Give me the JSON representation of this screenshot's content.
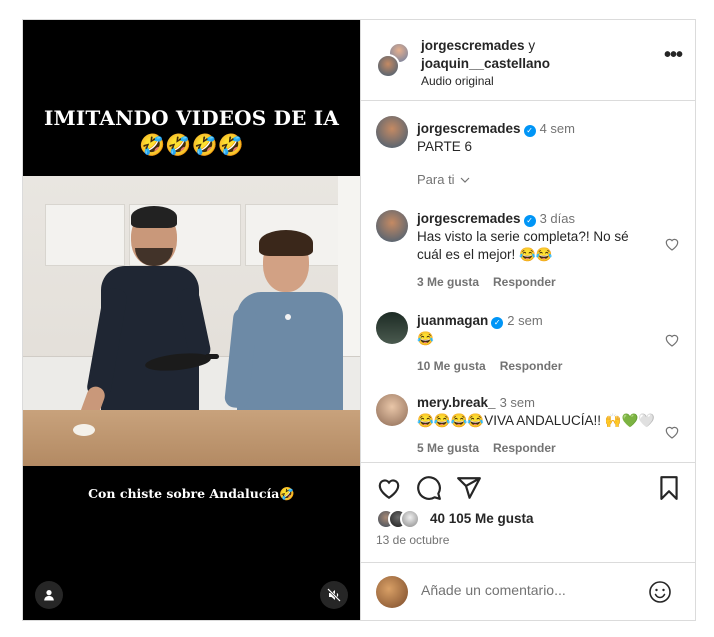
{
  "video": {
    "title": "IMITANDO VIDEOS DE IA",
    "title_emojis": "🤣🤣🤣🤣",
    "caption": "Con chiste sobre Andalucía🤣",
    "user_icon": "person-icon",
    "mute_icon": "speaker-muted-icon"
  },
  "header": {
    "user1": "jorgescremades",
    "conj": "y",
    "user2": "joaquin__castellano",
    "audio": "Audio original",
    "more": "•••"
  },
  "caption_comment": {
    "user": "jorgescremades",
    "time": "4 sem",
    "text": "PARTE 6",
    "see_translation": "Para ti"
  },
  "comments": [
    {
      "user": "jorgescremades",
      "verified": true,
      "time": "3 días",
      "text": "Has visto la serie completa?! No sé cuál es el mejor! 😂😂",
      "likes": "3 Me gusta",
      "reply": "Responder"
    },
    {
      "user": "juanmagan",
      "verified": true,
      "time": "2 sem",
      "text": "😂",
      "likes": "10 Me gusta",
      "reply": "Responder"
    },
    {
      "user": "mery.break_",
      "verified": false,
      "time": "3 sem",
      "text": "😂😂😂😂VIVA ANDALUCÍA!! 🙌💚🤍",
      "likes": "5 Me gusta",
      "reply": "Responder"
    }
  ],
  "actions": {
    "like_icon": "heart-icon",
    "comment_icon": "comment-icon",
    "share_icon": "share-icon",
    "save_icon": "bookmark-icon"
  },
  "likes_text": "40 105 Me gusta",
  "date": "13 de octubre",
  "add_comment": {
    "placeholder": "Añade un comentario...",
    "emoji_icon": "smiley-icon"
  },
  "colors": {
    "verified": "#0095f6",
    "text": "#262626",
    "muted": "#737373",
    "border": "#dbdbdb"
  }
}
